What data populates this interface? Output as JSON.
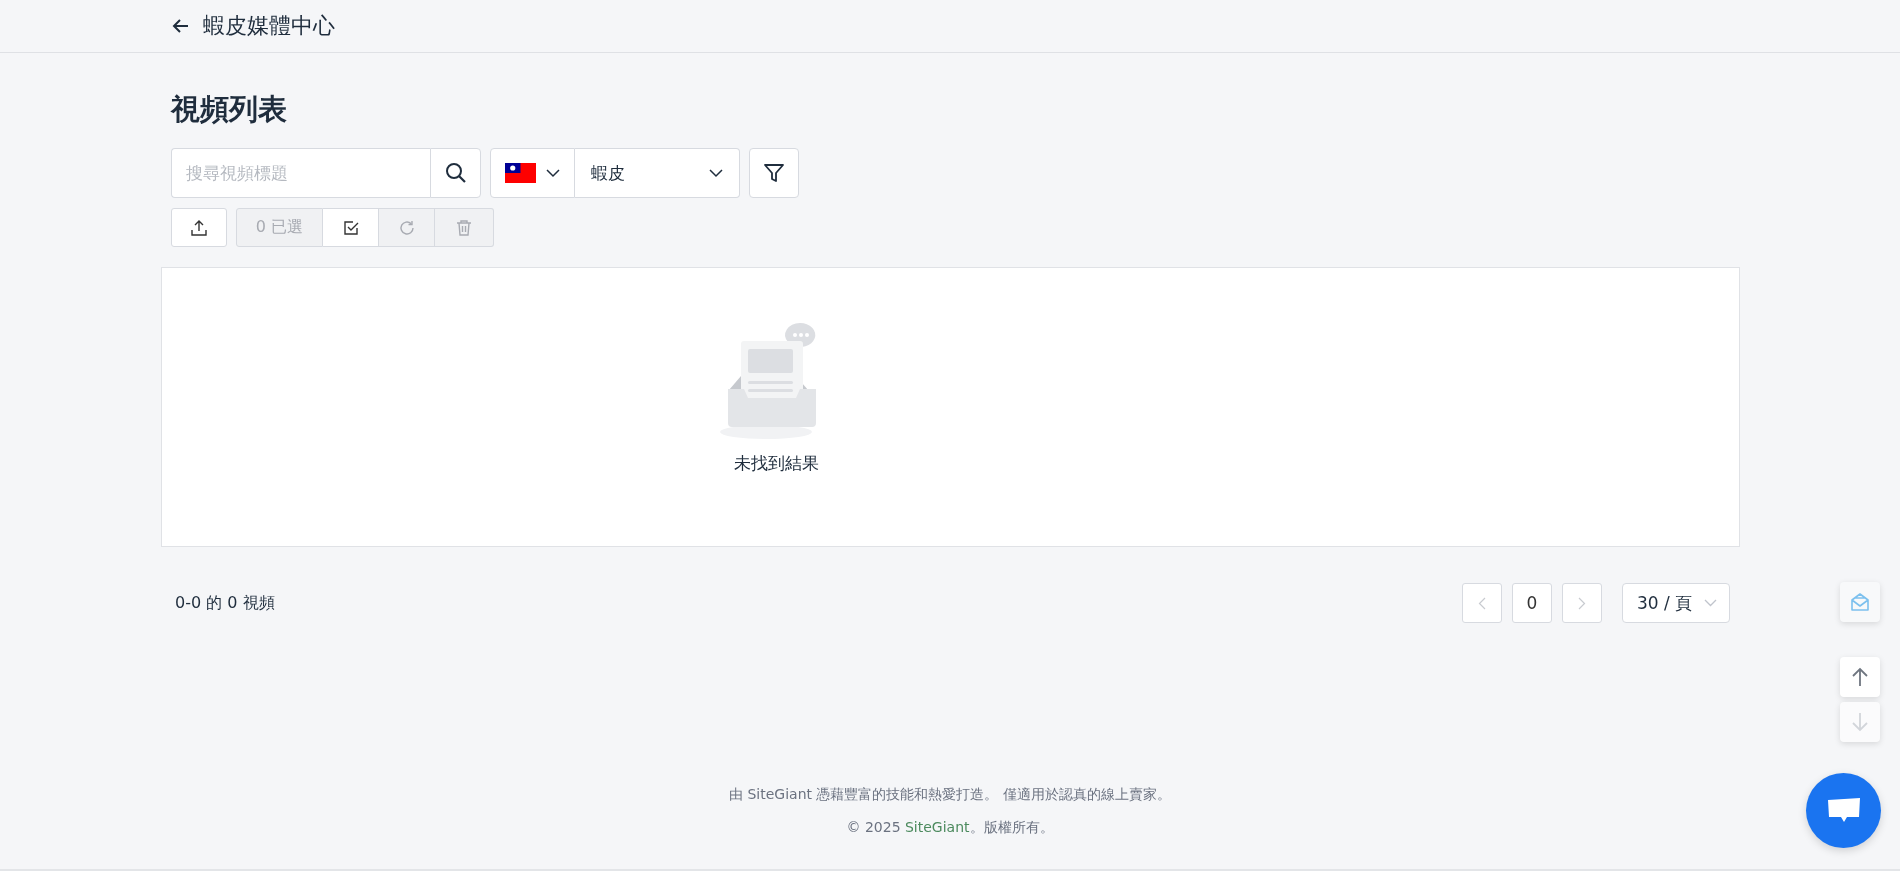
{
  "header": {
    "title": "蝦皮媒體中心"
  },
  "page_title": "視頻列表",
  "search": {
    "placeholder": "搜尋視頻標題"
  },
  "platform_select": {
    "value": "蝦皮"
  },
  "toolbar": [
    {
      "kind": "upload",
      "disabled": false
    },
    {
      "kind": "count",
      "text": "0 已選",
      "disabled": true
    },
    {
      "kind": "select-all",
      "disabled": false
    },
    {
      "kind": "refresh",
      "disabled": true
    },
    {
      "kind": "delete",
      "disabled": true
    }
  ],
  "empty_state": {
    "message": "未找到結果"
  },
  "summary": "0-0 的 0 視頻",
  "pagination": {
    "prev_disabled": true,
    "page": "0",
    "next_disabled": true,
    "page_size": "30 / 頁"
  },
  "side_buttons": [
    {
      "kind": "mail"
    },
    {
      "kind": "up",
      "disabled": false
    },
    {
      "kind": "down",
      "disabled": true
    }
  ],
  "footer": {
    "line1": "由 SiteGiant 憑藉豐富的技能和熱愛打造。 僅適用於認真的線上賣家。",
    "line2_prefix": "© 2025 ",
    "line2_link": "SiteGiant",
    "line2_suffix": "。版權所有。"
  }
}
